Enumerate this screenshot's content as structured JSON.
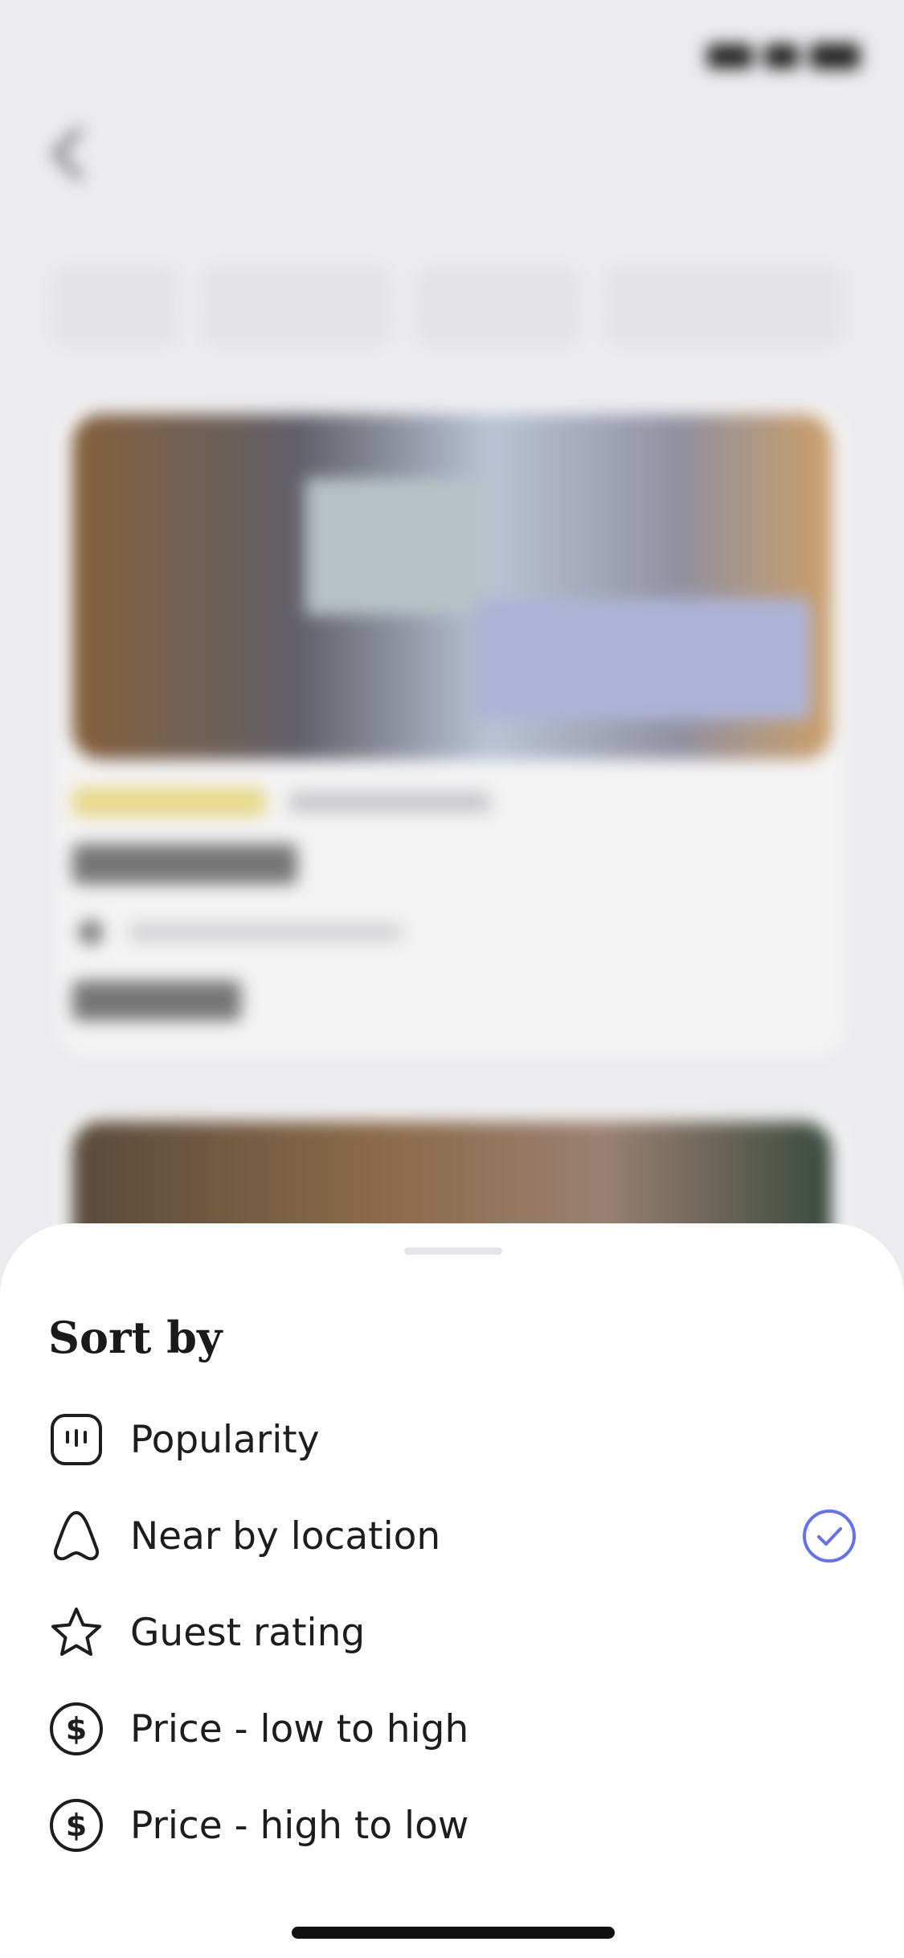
{
  "sort_sheet": {
    "title": "Sort by",
    "options": [
      {
        "label": "Popularity",
        "icon": "chart-box-icon",
        "selected": false
      },
      {
        "label": "Near by location",
        "icon": "location-pin-icon",
        "selected": true
      },
      {
        "label": "Guest rating",
        "icon": "star-icon",
        "selected": false
      },
      {
        "label": "Price - low to high",
        "icon": "dollar-circle-icon",
        "selected": false
      },
      {
        "label": "Price - high to low",
        "icon": "dollar-circle-icon",
        "selected": false
      }
    ]
  },
  "colors": {
    "accent": "#6571f0",
    "text": "#1d1d1f",
    "sheet_bg": "#ffffff",
    "backdrop": "#ececee"
  }
}
